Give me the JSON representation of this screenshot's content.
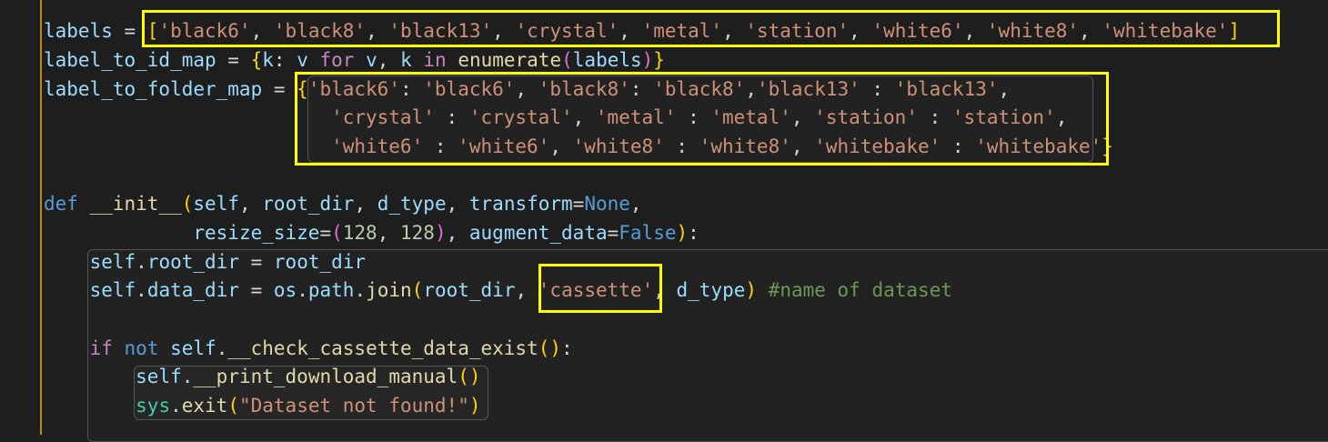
{
  "editor": {
    "language": "python",
    "accent_bar_color": "#c08a17",
    "highlight_color": "#ffff00",
    "lines": [
      {
        "tokens": [
          [
            "v",
            "labels"
          ],
          [
            "p",
            " = "
          ],
          [
            "b1",
            "["
          ],
          [
            "s",
            "'black6'"
          ],
          [
            "p",
            ", "
          ],
          [
            "s",
            "'black8'"
          ],
          [
            "p",
            ", "
          ],
          [
            "s",
            "'black13'"
          ],
          [
            "p",
            ", "
          ],
          [
            "s",
            "'crystal'"
          ],
          [
            "p",
            ", "
          ],
          [
            "s",
            "'metal'"
          ],
          [
            "p",
            ", "
          ],
          [
            "s",
            "'station'"
          ],
          [
            "p",
            ", "
          ],
          [
            "s",
            "'white6'"
          ],
          [
            "p",
            ", "
          ],
          [
            "s",
            "'white8'"
          ],
          [
            "p",
            ", "
          ],
          [
            "s",
            "'whitebake'"
          ],
          [
            "b1",
            "]"
          ]
        ]
      },
      {
        "tokens": [
          [
            "v",
            "label_to_id_map"
          ],
          [
            "p",
            " = "
          ],
          [
            "b1",
            "{"
          ],
          [
            "v",
            "k"
          ],
          [
            "p",
            ": "
          ],
          [
            "v",
            "v"
          ],
          [
            "p",
            " "
          ],
          [
            "k",
            "for"
          ],
          [
            "p",
            " "
          ],
          [
            "v",
            "v"
          ],
          [
            "p",
            ", "
          ],
          [
            "v",
            "k"
          ],
          [
            "p",
            " "
          ],
          [
            "k",
            "in"
          ],
          [
            "p",
            " "
          ],
          [
            "f",
            "enumerate"
          ],
          [
            "b2",
            "("
          ],
          [
            "v",
            "labels"
          ],
          [
            "b2",
            ")"
          ],
          [
            "b1",
            "}"
          ]
        ]
      },
      {
        "tokens": [
          [
            "v",
            "label_to_folder_map"
          ],
          [
            "p",
            " = "
          ],
          [
            "b1",
            "{"
          ],
          [
            "s",
            "'black6'"
          ],
          [
            "p",
            ": "
          ],
          [
            "s",
            "'black6'"
          ],
          [
            "p",
            ", "
          ],
          [
            "s",
            "'black8'"
          ],
          [
            "p",
            ": "
          ],
          [
            "s",
            "'black8'"
          ],
          [
            "p",
            ","
          ],
          [
            "s",
            "'black13'"
          ],
          [
            "p",
            " : "
          ],
          [
            "s",
            "'black13'"
          ],
          [
            "p",
            ","
          ]
        ]
      },
      {
        "tokens": [
          [
            "p",
            "                         "
          ],
          [
            "s",
            "'crystal'"
          ],
          [
            "p",
            " : "
          ],
          [
            "s",
            "'crystal'"
          ],
          [
            "p",
            ", "
          ],
          [
            "s",
            "'metal'"
          ],
          [
            "p",
            " : "
          ],
          [
            "s",
            "'metal'"
          ],
          [
            "p",
            ", "
          ],
          [
            "s",
            "'station'"
          ],
          [
            "p",
            " : "
          ],
          [
            "s",
            "'station'"
          ],
          [
            "p",
            ","
          ]
        ]
      },
      {
        "tokens": [
          [
            "p",
            "                         "
          ],
          [
            "s",
            "'white6'"
          ],
          [
            "p",
            " : "
          ],
          [
            "s",
            "'white6'"
          ],
          [
            "p",
            ", "
          ],
          [
            "s",
            "'white8'"
          ],
          [
            "p",
            " : "
          ],
          [
            "s",
            "'white8'"
          ],
          [
            "p",
            ", "
          ],
          [
            "s",
            "'whitebake'"
          ],
          [
            "p",
            " : "
          ],
          [
            "s",
            "'whitebake'"
          ],
          [
            "b1",
            "}"
          ]
        ]
      },
      {
        "tokens": []
      },
      {
        "tokens": [
          [
            "d",
            "def"
          ],
          [
            "p",
            " "
          ],
          [
            "f",
            "__init__"
          ],
          [
            "b1",
            "("
          ],
          [
            "v",
            "self"
          ],
          [
            "p",
            ", "
          ],
          [
            "v",
            "root_dir"
          ],
          [
            "p",
            ", "
          ],
          [
            "v",
            "d_type"
          ],
          [
            "p",
            ", "
          ],
          [
            "v",
            "transform"
          ],
          [
            "p",
            "="
          ],
          [
            "d",
            "None"
          ],
          [
            "p",
            ","
          ]
        ]
      },
      {
        "tokens": [
          [
            "p",
            "             "
          ],
          [
            "v",
            "resize_size"
          ],
          [
            "p",
            "="
          ],
          [
            "b2",
            "("
          ],
          [
            "n",
            "128"
          ],
          [
            "p",
            ", "
          ],
          [
            "n",
            "128"
          ],
          [
            "b2",
            ")"
          ],
          [
            "p",
            ", "
          ],
          [
            "v",
            "augment_data"
          ],
          [
            "p",
            "="
          ],
          [
            "d",
            "False"
          ],
          [
            "b1",
            ")"
          ],
          [
            "p",
            ":"
          ]
        ]
      },
      {
        "tokens": [
          [
            "p",
            "    "
          ],
          [
            "v",
            "self"
          ],
          [
            "p",
            "."
          ],
          [
            "v",
            "root_dir"
          ],
          [
            "p",
            " = "
          ],
          [
            "v",
            "root_dir"
          ]
        ]
      },
      {
        "tokens": [
          [
            "p",
            "    "
          ],
          [
            "v",
            "self"
          ],
          [
            "p",
            "."
          ],
          [
            "v",
            "data_dir"
          ],
          [
            "p",
            " = "
          ],
          [
            "v",
            "os"
          ],
          [
            "p",
            "."
          ],
          [
            "v",
            "path"
          ],
          [
            "p",
            "."
          ],
          [
            "f",
            "join"
          ],
          [
            "b1",
            "("
          ],
          [
            "v",
            "root_dir"
          ],
          [
            "p",
            ", "
          ],
          [
            "s",
            "'cassette'"
          ],
          [
            "p",
            ", "
          ],
          [
            "v",
            "d_type"
          ],
          [
            "b1",
            ")"
          ],
          [
            "p",
            " "
          ],
          [
            "c",
            "#name of dataset"
          ]
        ]
      },
      {
        "tokens": []
      },
      {
        "tokens": [
          [
            "p",
            "    "
          ],
          [
            "k",
            "if"
          ],
          [
            "p",
            " "
          ],
          [
            "d",
            "not"
          ],
          [
            "p",
            " "
          ],
          [
            "v",
            "self"
          ],
          [
            "p",
            "."
          ],
          [
            "f",
            "__check_cassette_data_exist"
          ],
          [
            "b1",
            "()"
          ],
          [
            "p",
            ":"
          ]
        ]
      },
      {
        "tokens": [
          [
            "p",
            "        "
          ],
          [
            "v",
            "self"
          ],
          [
            "p",
            "."
          ],
          [
            "f",
            "__print_download_manual"
          ],
          [
            "b1",
            "()"
          ]
        ]
      },
      {
        "tokens": [
          [
            "p",
            "        "
          ],
          [
            "t",
            "sys"
          ],
          [
            "p",
            "."
          ],
          [
            "f",
            "exit"
          ],
          [
            "b1",
            "("
          ],
          [
            "s",
            "\"Dataset not found!\""
          ],
          [
            "b1",
            ")"
          ]
        ]
      }
    ]
  }
}
